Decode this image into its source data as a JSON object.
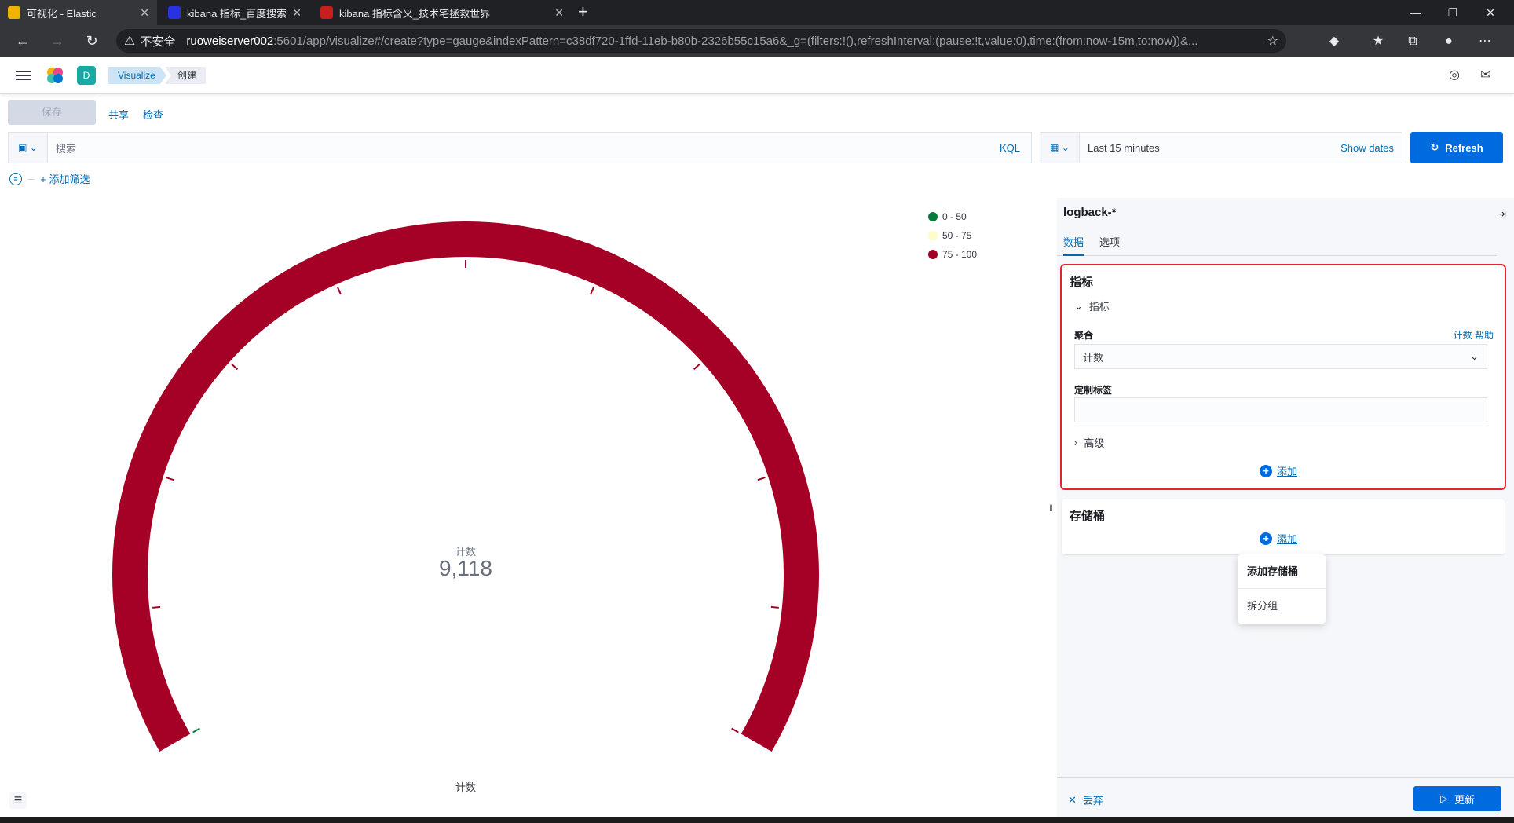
{
  "browser": {
    "tabs": [
      {
        "title": "可视化 - Elastic",
        "active": true,
        "favicon_color": "#f0b400"
      },
      {
        "title": "kibana 指标_百度搜索",
        "active": false,
        "favicon_color": "#2932e1"
      },
      {
        "title": "kibana 指标含义_技术宅拯救世界",
        "active": false,
        "favicon_color": "#c81e1e"
      }
    ],
    "insecure_label": "不安全",
    "url_host": "ruoweiserver002",
    "url_path": ":5601/app/visualize#/create?type=gauge&indexPattern=c38df720-1ffd-11eb-b80b-2326b55c15a6&_g=(filters:!(),refreshInterval:(pause:!t,value:0),time:(from:now-15m,to:now))&..."
  },
  "header": {
    "space_initial": "D",
    "breadcrumbs": [
      "Visualize",
      "创建"
    ]
  },
  "topnav": {
    "save": "保存",
    "share": "共享",
    "inspect": "检查"
  },
  "query": {
    "placeholder": "搜索",
    "language": "KQL",
    "time_label": "Last 15 minutes",
    "show_dates": "Show dates",
    "refresh": "Refresh",
    "add_filter": "+ 添加筛选"
  },
  "visualization": {
    "legend": [
      {
        "label": "0 - 50",
        "color": "#017d3b"
      },
      {
        "label": "50 - 75",
        "color": "#fefdc8"
      },
      {
        "label": "75 - 100",
        "color": "#a50026"
      }
    ],
    "metric_label": "计数",
    "metric_value": "9,118",
    "bottom_label": "计数",
    "gauge_fill_color": "#a50026",
    "gauge_level_percent": 100
  },
  "sidebar": {
    "index_pattern": "logback-*",
    "tabs": [
      "数据",
      "选项"
    ],
    "metrics": {
      "title": "指标",
      "item_label": "指标",
      "aggregation_label": "聚合",
      "help_link": "计数 帮助",
      "aggregation_value": "计数",
      "custom_label": "定制标签",
      "custom_label_value": "",
      "advanced": "高级",
      "add": "添加"
    },
    "buckets": {
      "title": "存储桶",
      "add": "添加",
      "menu": [
        "添加存储桶",
        "拆分组"
      ]
    },
    "discard": "丢弃",
    "update": "更新"
  }
}
